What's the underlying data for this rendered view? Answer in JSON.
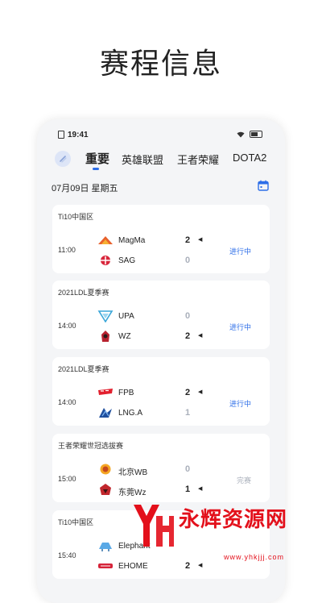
{
  "headline": "赛程信息",
  "status_bar": {
    "time": "19:41"
  },
  "tabs": [
    {
      "label": "重要",
      "active": true
    },
    {
      "label": "英雄联盟",
      "active": false
    },
    {
      "label": "王者荣耀",
      "active": false
    },
    {
      "label": "DOTA2",
      "active": false
    }
  ],
  "date": "07月09日 星期五",
  "colors": {
    "accent": "#2d6ee8",
    "muted": "#aab0bb",
    "background": "#f4f5f7",
    "watermark": "#e3101b"
  },
  "matches": [
    {
      "league": "Ti10中国区",
      "time": "11:00",
      "team1": {
        "name": "MagMa",
        "score": "2",
        "winner": true,
        "logo": "magma-logo-icon"
      },
      "team2": {
        "name": "SAG",
        "score": "0",
        "winner": false,
        "logo": "sag-logo-icon"
      },
      "status": "进行中",
      "state": "live"
    },
    {
      "league": "2021LDL夏季赛",
      "time": "14:00",
      "team1": {
        "name": "UPA",
        "score": "0",
        "winner": false,
        "logo": "upa-logo-icon"
      },
      "team2": {
        "name": "WZ",
        "score": "2",
        "winner": true,
        "logo": "wz-logo-icon"
      },
      "status": "进行中",
      "state": "live"
    },
    {
      "league": "2021LDL夏季赛",
      "time": "14:00",
      "team1": {
        "name": "FPB",
        "score": "2",
        "winner": true,
        "logo": "fpb-logo-icon"
      },
      "team2": {
        "name": "LNG.A",
        "score": "1",
        "winner": false,
        "logo": "lnga-logo-icon"
      },
      "status": "进行中",
      "state": "live"
    },
    {
      "league": "王者荣耀世冠选拔赛",
      "time": "15:00",
      "team1": {
        "name": "北京WB",
        "score": "0",
        "winner": false,
        "logo": "beijing-wb-logo-icon"
      },
      "team2": {
        "name": "东莞Wz",
        "score": "1",
        "winner": true,
        "logo": "dongguan-wz-logo-icon"
      },
      "status": "完赛",
      "state": "done"
    },
    {
      "league": "Ti10中国区",
      "time": "15:40",
      "team1": {
        "name": "Elephant",
        "score": "",
        "winner": false,
        "logo": "elephant-logo-icon"
      },
      "team2": {
        "name": "EHOME",
        "score": "2",
        "winner": true,
        "logo": "ehome-logo-icon"
      },
      "status": "",
      "state": "live"
    }
  ],
  "watermark": {
    "title": "永辉资源网",
    "url": "www.yhkjjj.com"
  }
}
